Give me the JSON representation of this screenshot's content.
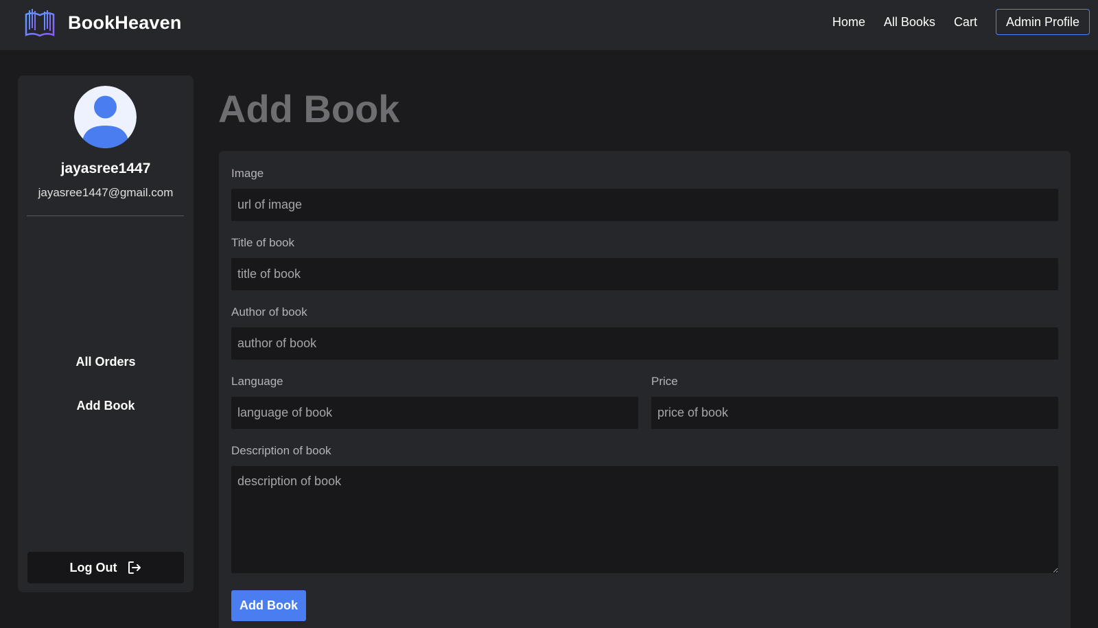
{
  "brand": {
    "name": "BookHeaven",
    "logo_icon": "open-book-icon"
  },
  "nav": {
    "links": [
      "Home",
      "All Books",
      "Cart"
    ],
    "profile_button": "Admin Profile"
  },
  "sidebar": {
    "avatar_icon": "user-avatar-icon",
    "username": "jayasree1447",
    "email": "jayasree1447@gmail.com",
    "links": [
      "All Orders",
      "Add Book"
    ],
    "logout_label": "Log Out",
    "logout_icon": "logout-arrow-icon"
  },
  "main": {
    "title": "Add Book",
    "form": {
      "image": {
        "label": "Image",
        "placeholder": "url of image",
        "value": ""
      },
      "title": {
        "label": "Title of book",
        "placeholder": "title of book",
        "value": ""
      },
      "author": {
        "label": "Author of book",
        "placeholder": "author of book",
        "value": ""
      },
      "language": {
        "label": "Language",
        "placeholder": "language of book",
        "value": ""
      },
      "price": {
        "label": "Price",
        "placeholder": "price of book",
        "value": ""
      },
      "description": {
        "label": "Description of book",
        "placeholder": "description of book",
        "value": ""
      },
      "submit_label": "Add Book"
    }
  },
  "colors": {
    "accent": "#4a7ef0",
    "header_bg": "#26272a",
    "page_bg": "#1b1b1e",
    "input_bg": "#18181b"
  }
}
